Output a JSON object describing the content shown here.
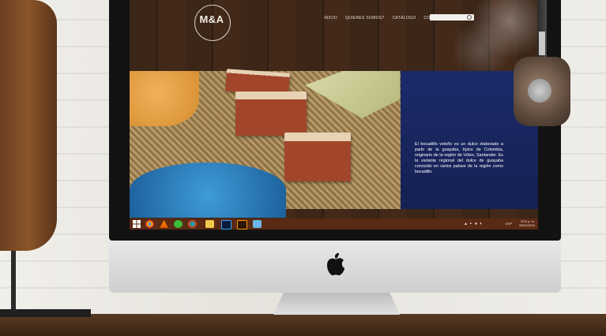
{
  "site": {
    "logo_text": "M&A",
    "nav": [
      "INICIO",
      "QUIENES SOMOS?",
      "CATÁLOGO",
      "CONTÁCTENOS"
    ],
    "search_placeholder": "",
    "description": "El bocadillo veleño es un dulce elaborado a partir de la guayaba, típico de Colombia, originario de la región de Vélez, Santander. Es la variante regional del dulce de guayaba conocido en varios países de la región como bocadillo."
  },
  "taskbar": {
    "apps": [
      "chrome",
      "vlc",
      "utorrent",
      "chrome",
      "file-explorer",
      "photoshop",
      "illustrator",
      "mail"
    ],
    "lang": "ESP",
    "time": "5:01 p. m.",
    "date": "25/01/2016"
  },
  "colors": {
    "brand_blue": "#1c2a6a",
    "taskbar": "#5a2a14",
    "wood": "#3b2618"
  }
}
